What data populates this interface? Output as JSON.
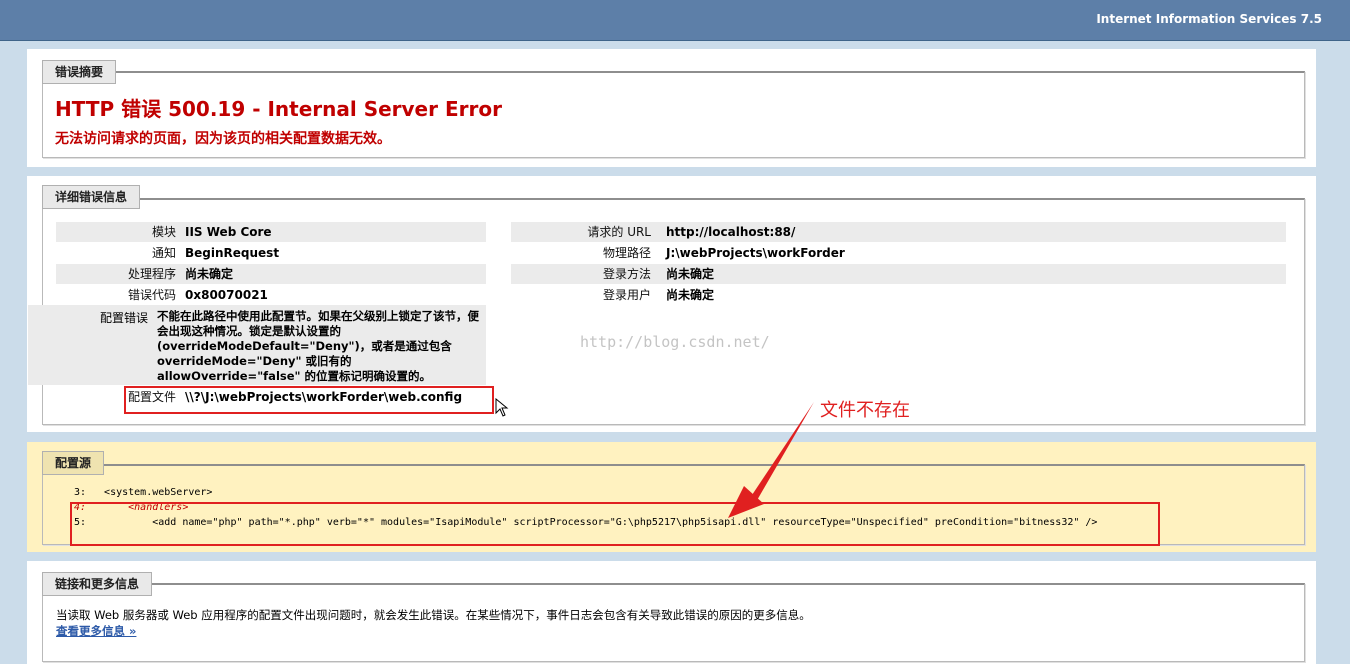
{
  "header": {
    "product": "Internet Information Services 7.5"
  },
  "summary": {
    "legend": "错误摘要",
    "title": "HTTP 错误 500.19 - Internal Server Error",
    "subtitle": "无法访问请求的页面，因为该页的相关配置数据无效。"
  },
  "details": {
    "legend": "详细错误信息",
    "left": [
      {
        "label": "模块",
        "value": "IIS Web Core"
      },
      {
        "label": "通知",
        "value": "BeginRequest"
      },
      {
        "label": "处理程序",
        "value": "尚未确定"
      },
      {
        "label": "错误代码",
        "value": "0x80070021"
      }
    ],
    "config_error": {
      "label": "配置错误",
      "value": "不能在此路径中使用此配置节。如果在父级别上锁定了该节，便会出现这种情况。锁定是默认设置的(overrideModeDefault=\"Deny\")，或者是通过包含 overrideMode=\"Deny\" 或旧有的 allowOverride=\"false\" 的位置标记明确设置的。"
    },
    "config_file": {
      "label": "配置文件",
      "value": "\\\\?\\J:\\webProjects\\workForder\\web.config"
    },
    "right": [
      {
        "label": "请求的 URL",
        "value": "http://localhost:88/"
      },
      {
        "label": "物理路径",
        "value": "J:\\webProjects\\workForder"
      },
      {
        "label": "登录方法",
        "value": "尚未确定"
      },
      {
        "label": "登录用户",
        "value": "尚未确定"
      }
    ]
  },
  "watermark": "http://blog.csdn.net/",
  "annotation": {
    "text": "文件不存在",
    "color": "#e02020"
  },
  "config_source": {
    "legend": "配置源",
    "lines": [
      {
        "num": "3:",
        "code": "   <system.webServer>"
      },
      {
        "num": "4:",
        "code": "       <handlers>"
      },
      {
        "num": "5:",
        "code": "           <add name=\"php\" path=\"*.php\" verb=\"*\" modules=\"IsapiModule\" scriptProcessor=\"G:\\php5217\\php5isapi.dll\" resourceType=\"Unspecified\" preCondition=\"bitness32\" />"
      }
    ]
  },
  "more_info": {
    "legend": "链接和更多信息",
    "text": "当读取 Web 服务器或 Web 应用程序的配置文件出现问题时，就会发生此错误。在某些情况下，事件日志会包含有关导致此错误的原因的更多信息。",
    "link": "查看更多信息 »"
  },
  "colors": {
    "error_red": "#c00000",
    "header_blue": "#5d7fa8",
    "page_bg": "#cbdcea",
    "source_bg": "#fff2c0",
    "link": "#2d5aa8"
  }
}
